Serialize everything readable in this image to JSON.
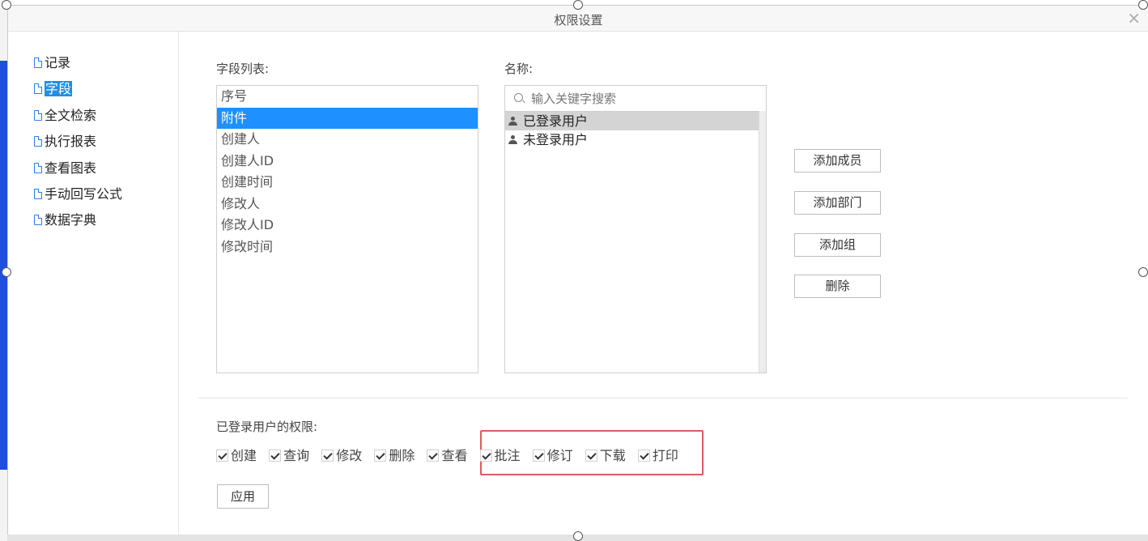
{
  "dialog": {
    "title": "权限设置",
    "close_glyph": "×"
  },
  "sidebar": {
    "items": [
      {
        "label": "记录",
        "active": false
      },
      {
        "label": "字段",
        "active": true
      },
      {
        "label": "全文检索",
        "active": false
      },
      {
        "label": "执行报表",
        "active": false
      },
      {
        "label": "查看图表",
        "active": false
      },
      {
        "label": "手动回写公式",
        "active": false
      },
      {
        "label": "数据字典",
        "active": false
      }
    ]
  },
  "fields": {
    "label": "字段列表:",
    "items": [
      "序号",
      "附件",
      "创建人",
      "创建人ID",
      "创建时间",
      "修改人",
      "修改人ID",
      "修改时间"
    ],
    "selected": "附件"
  },
  "members": {
    "label": "名称:",
    "search_placeholder": "输入关键字搜索",
    "items": [
      "已登录用户",
      "未登录用户"
    ],
    "selected": "已登录用户"
  },
  "actions": {
    "add_member": "添加成员",
    "add_department": "添加部门",
    "add_group": "添加组",
    "delete": "删除"
  },
  "permissions": {
    "label": "已登录用户的权限:",
    "items": [
      {
        "label": "创建",
        "checked": true
      },
      {
        "label": "查询",
        "checked": true
      },
      {
        "label": "修改",
        "checked": true
      },
      {
        "label": "删除",
        "checked": true
      },
      {
        "label": "查看",
        "checked": true
      },
      {
        "label": "批注",
        "checked": true
      },
      {
        "label": "修订",
        "checked": true
      },
      {
        "label": "下载",
        "checked": true
      },
      {
        "label": "打印",
        "checked": true
      }
    ],
    "apply_label": "应用"
  },
  "colors": {
    "selection": "#1e90ff",
    "highlight_border": "#e05a5a",
    "backdrop_accent": "#1f4fe0"
  }
}
